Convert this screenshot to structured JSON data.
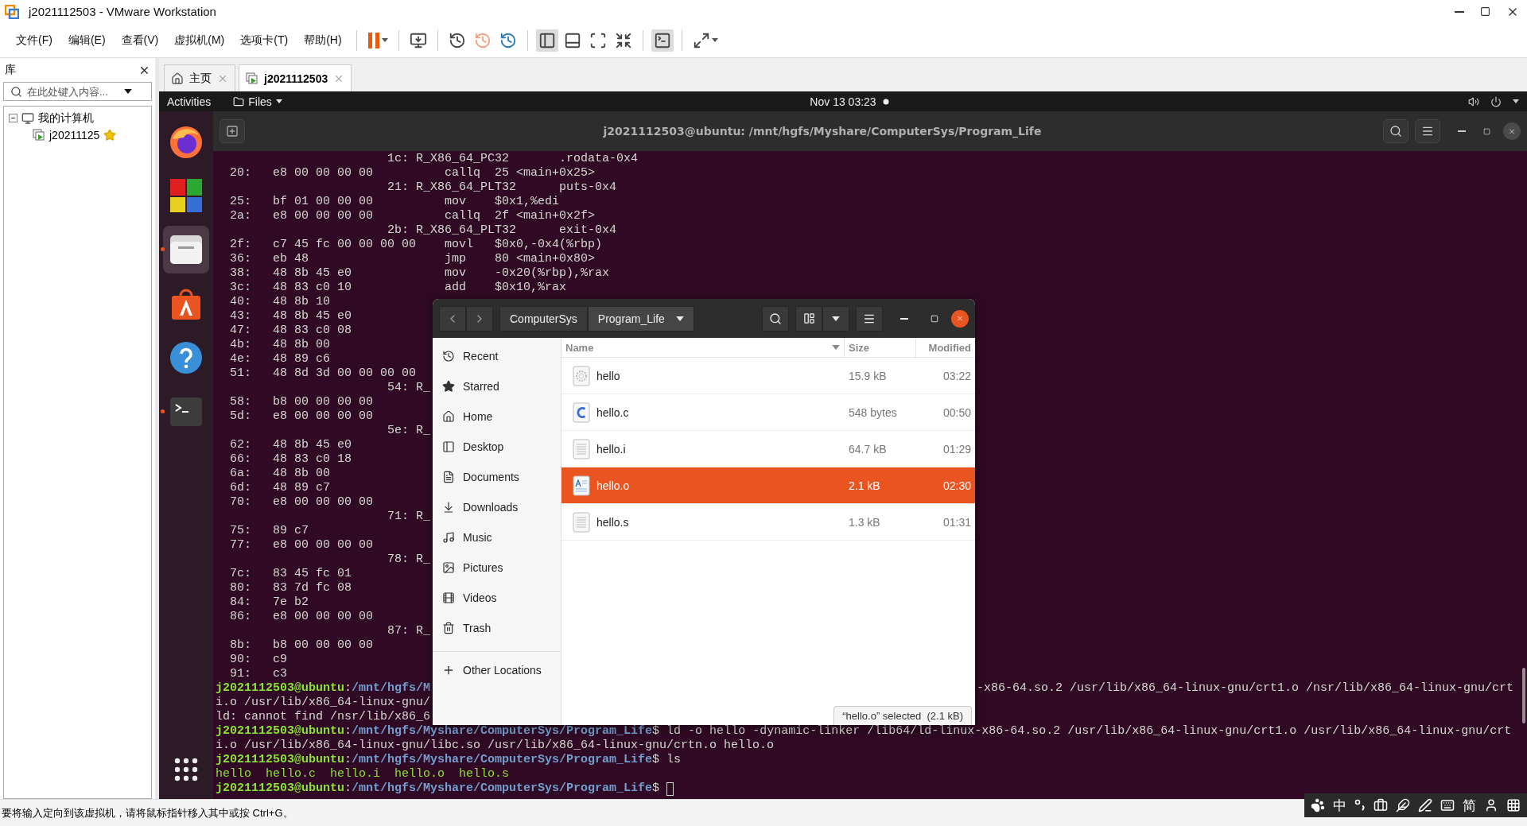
{
  "window": {
    "title": "j2021112503 - VMware Workstation"
  },
  "menu": [
    "文件(F)",
    "编辑(E)",
    "查看(V)",
    "虚拟机(M)",
    "选项卡(T)",
    "帮助(H)"
  ],
  "library": {
    "title": "库",
    "search": {
      "placeholder": "在此处键入内容..."
    },
    "tree": [
      {
        "label": "我的计算机",
        "expanded": true,
        "children": [
          {
            "label": "j20211125",
            "starred": true
          }
        ]
      }
    ]
  },
  "tabs": [
    {
      "label": "主页",
      "kind": "home",
      "selected": false
    },
    {
      "label": "j2021112503",
      "kind": "vm",
      "selected": true
    }
  ],
  "guest": {
    "topbar": {
      "activities": "Activities",
      "app_menu": "Files",
      "clock": "Nov 13  03:23"
    },
    "dock": [
      {
        "kind": "firefox",
        "selected": false,
        "running": false
      },
      {
        "kind": "blocks",
        "selected": false,
        "running": false
      },
      {
        "kind": "files",
        "selected": true,
        "running": true
      },
      {
        "kind": "store",
        "selected": false,
        "running": false
      },
      {
        "kind": "help",
        "selected": false,
        "running": false
      },
      {
        "kind": "terminal",
        "selected": false,
        "running": true
      }
    ],
    "terminal": {
      "title": "j2021112503@ubuntu: /mnt/hgfs/Myshare/ComputerSys/Program_Life",
      "lines": [
        {
          "segments": [
            {
              "kind": "plain",
              "text": "                        1c: R_X86_64_PC32       .rodata-0x4"
            }
          ]
        },
        {
          "segments": [
            {
              "kind": "plain",
              "text": "  20:   e8 00 00 00 00          callq  25 <main+0x25>"
            }
          ]
        },
        {
          "segments": [
            {
              "kind": "plain",
              "text": "                        21: R_X86_64_PLT32      puts-0x4"
            }
          ]
        },
        {
          "segments": [
            {
              "kind": "plain",
              "text": "  25:   bf 01 00 00 00          mov    $0x1,%edi"
            }
          ]
        },
        {
          "segments": [
            {
              "kind": "plain",
              "text": "  2a:   e8 00 00 00 00          callq  2f <main+0x2f>"
            }
          ]
        },
        {
          "segments": [
            {
              "kind": "plain",
              "text": "                        2b: R_X86_64_PLT32      exit-0x4"
            }
          ]
        },
        {
          "segments": [
            {
              "kind": "plain",
              "text": "  2f:   c7 45 fc 00 00 00 00    movl   $0x0,-0x4(%rbp)"
            }
          ]
        },
        {
          "segments": [
            {
              "kind": "plain",
              "text": "  36:   eb 48                   jmp    80 <main+0x80>"
            }
          ]
        },
        {
          "segments": [
            {
              "kind": "plain",
              "text": "  38:   48 8b 45 e0             mov    -0x20(%rbp),%rax"
            }
          ]
        },
        {
          "segments": [
            {
              "kind": "plain",
              "text": "  3c:   48 83 c0 10             add    $0x10,%rax"
            }
          ]
        },
        {
          "segments": [
            {
              "kind": "plain",
              "text": "  40:   48 8b 10"
            }
          ]
        },
        {
          "segments": [
            {
              "kind": "plain",
              "text": "  43:   48 8b 45 e0"
            }
          ]
        },
        {
          "segments": [
            {
              "kind": "plain",
              "text": "  47:   48 83 c0 08"
            }
          ]
        },
        {
          "segments": [
            {
              "kind": "plain",
              "text": "  4b:   48 8b 00"
            }
          ]
        },
        {
          "segments": [
            {
              "kind": "plain",
              "text": "  4e:   48 89 c6"
            }
          ]
        },
        {
          "segments": [
            {
              "kind": "plain",
              "text": "  51:   48 8d 3d 00 00 00 00"
            }
          ]
        },
        {
          "segments": [
            {
              "kind": "plain",
              "text": "                        54: R_"
            }
          ]
        },
        {
          "segments": [
            {
              "kind": "plain",
              "text": "  58:   b8 00 00 00 00"
            }
          ]
        },
        {
          "segments": [
            {
              "kind": "plain",
              "text": "  5d:   e8 00 00 00 00"
            }
          ]
        },
        {
          "segments": [
            {
              "kind": "plain",
              "text": "                        5e: R_"
            }
          ]
        },
        {
          "segments": [
            {
              "kind": "plain",
              "text": "  62:   48 8b 45 e0"
            }
          ]
        },
        {
          "segments": [
            {
              "kind": "plain",
              "text": "  66:   48 83 c0 18"
            }
          ]
        },
        {
          "segments": [
            {
              "kind": "plain",
              "text": "  6a:   48 8b 00"
            }
          ]
        },
        {
          "segments": [
            {
              "kind": "plain",
              "text": "  6d:   48 89 c7"
            }
          ]
        },
        {
          "segments": [
            {
              "kind": "plain",
              "text": "  70:   e8 00 00 00 00"
            }
          ]
        },
        {
          "segments": [
            {
              "kind": "plain",
              "text": "                        71: R_"
            }
          ]
        },
        {
          "segments": [
            {
              "kind": "plain",
              "text": "  75:   89 c7"
            }
          ]
        },
        {
          "segments": [
            {
              "kind": "plain",
              "text": "  77:   e8 00 00 00 00"
            }
          ]
        },
        {
          "segments": [
            {
              "kind": "plain",
              "text": "                        78: R_"
            }
          ]
        },
        {
          "segments": [
            {
              "kind": "plain",
              "text": "  7c:   83 45 fc 01"
            }
          ]
        },
        {
          "segments": [
            {
              "kind": "plain",
              "text": "  80:   83 7d fc 08"
            }
          ]
        },
        {
          "segments": [
            {
              "kind": "plain",
              "text": "  84:   7e b2"
            }
          ]
        },
        {
          "segments": [
            {
              "kind": "plain",
              "text": "  86:   e8 00 00 00 00"
            }
          ]
        },
        {
          "segments": [
            {
              "kind": "plain",
              "text": "                        87: R_"
            }
          ]
        },
        {
          "segments": [
            {
              "kind": "plain",
              "text": "  8b:   b8 00 00 00 00"
            }
          ]
        },
        {
          "segments": [
            {
              "kind": "plain",
              "text": "  90:   c9"
            }
          ]
        },
        {
          "segments": [
            {
              "kind": "plain",
              "text": "  91:   c3"
            }
          ]
        },
        {
          "segments": [
            {
              "kind": "user",
              "text": "j2021112503@ubuntu"
            },
            {
              "kind": "plain",
              "text": ":"
            },
            {
              "kind": "path",
              "text": "/mnt/hgfs/M"
            }
          ],
          "tail": "-x86-64.so.2 /usr/lib/x86_64-linux-gnu/crt1.o /nsr/lib/x86_64-linux-gnu/crt"
        },
        {
          "segments": [
            {
              "kind": "plain",
              "text": "i.o /usr/lib/x86_64-linux-gnu/"
            }
          ]
        },
        {
          "segments": [
            {
              "kind": "plain",
              "text": "ld: cannot find /nsr/lib/x86_6"
            }
          ]
        },
        {
          "segments": [
            {
              "kind": "user",
              "text": "j2021112503@ubuntu"
            },
            {
              "kind": "plain",
              "text": ":"
            },
            {
              "kind": "path",
              "text": "/mnt/hgfs/Myshare/ComputerSys/Program_Life"
            },
            {
              "kind": "plain",
              "text": "$ ld -o hello -dynamic-linker /lib64/ld-linux-x86-64.so.2 /usr/lib/x86_64-linux-gnu/crt1.o /usr/lib/x86_64-linux-gnu/crt"
            }
          ]
        },
        {
          "segments": [
            {
              "kind": "plain",
              "text": "i.o /usr/lib/x86_64-linux-gnu/libc.so /usr/lib/x86_64-linux-gnu/crtn.o hello.o"
            }
          ]
        },
        {
          "segments": [
            {
              "kind": "user",
              "text": "j2021112503@ubuntu"
            },
            {
              "kind": "plain",
              "text": ":"
            },
            {
              "kind": "path",
              "text": "/mnt/hgfs/Myshare/ComputerSys/Program_Life"
            },
            {
              "kind": "plain",
              "text": "$ ls"
            }
          ]
        },
        {
          "segments": [
            {
              "kind": "listing",
              "text": "hello  hello.c  hello.i  hello.o  hello.s"
            }
          ]
        },
        {
          "segments": [
            {
              "kind": "user",
              "text": "j2021112503@ubuntu"
            },
            {
              "kind": "plain",
              "text": ":"
            },
            {
              "kind": "path",
              "text": "/mnt/hgfs/Myshare/ComputerSys/Program_Life"
            },
            {
              "kind": "plain",
              "text": "$"
            }
          ],
          "cursor": true
        }
      ]
    },
    "files": {
      "path": [
        {
          "label": "ComputerSys",
          "selected": false
        },
        {
          "label": "Program_Life",
          "selected": true
        }
      ],
      "places": [
        {
          "label": "Recent",
          "kind": "recent"
        },
        {
          "label": "Starred",
          "kind": "starred"
        },
        {
          "label": "Home",
          "kind": "home"
        },
        {
          "label": "Desktop",
          "kind": "desktop"
        },
        {
          "label": "Documents",
          "kind": "documents"
        },
        {
          "label": "Downloads",
          "kind": "downloads"
        },
        {
          "label": "Music",
          "kind": "music"
        },
        {
          "label": "Pictures",
          "kind": "pictures"
        },
        {
          "label": "Videos",
          "kind": "videos"
        },
        {
          "label": "Trash",
          "kind": "trash"
        }
      ],
      "other": "Other Locations",
      "columns": [
        "Name",
        "Size",
        "Modified"
      ],
      "rows": [
        {
          "name": "hello",
          "kind": "executable",
          "size": "15.9 kB",
          "modified": "03:22",
          "selected": false
        },
        {
          "name": "hello.c",
          "kind": "csource",
          "size": "548 bytes",
          "modified": "00:50",
          "selected": false
        },
        {
          "name": "hello.i",
          "kind": "text",
          "size": "64.7 kB",
          "modified": "01:29",
          "selected": false
        },
        {
          "name": "hello.o",
          "kind": "object",
          "size": "2.1 kB",
          "modified": "02:30",
          "selected": true
        },
        {
          "name": "hello.s",
          "kind": "text",
          "size": "1.3 kB",
          "modified": "01:31",
          "selected": false
        }
      ],
      "status": "“hello.o” selected  (2.1 kB)"
    }
  },
  "status_bar": "要将输入定向到该虚拟机，请将鼠标指针移入其中或按 Ctrl+G。",
  "ime": [
    {
      "kind": "paw"
    },
    {
      "kind": "text",
      "text": "中"
    },
    {
      "kind": "punct"
    },
    {
      "kind": "toolbox"
    },
    {
      "kind": "feather"
    },
    {
      "kind": "pen"
    },
    {
      "kind": "keyboard"
    },
    {
      "kind": "text",
      "text": "简"
    },
    {
      "kind": "person"
    },
    {
      "kind": "grid"
    }
  ]
}
